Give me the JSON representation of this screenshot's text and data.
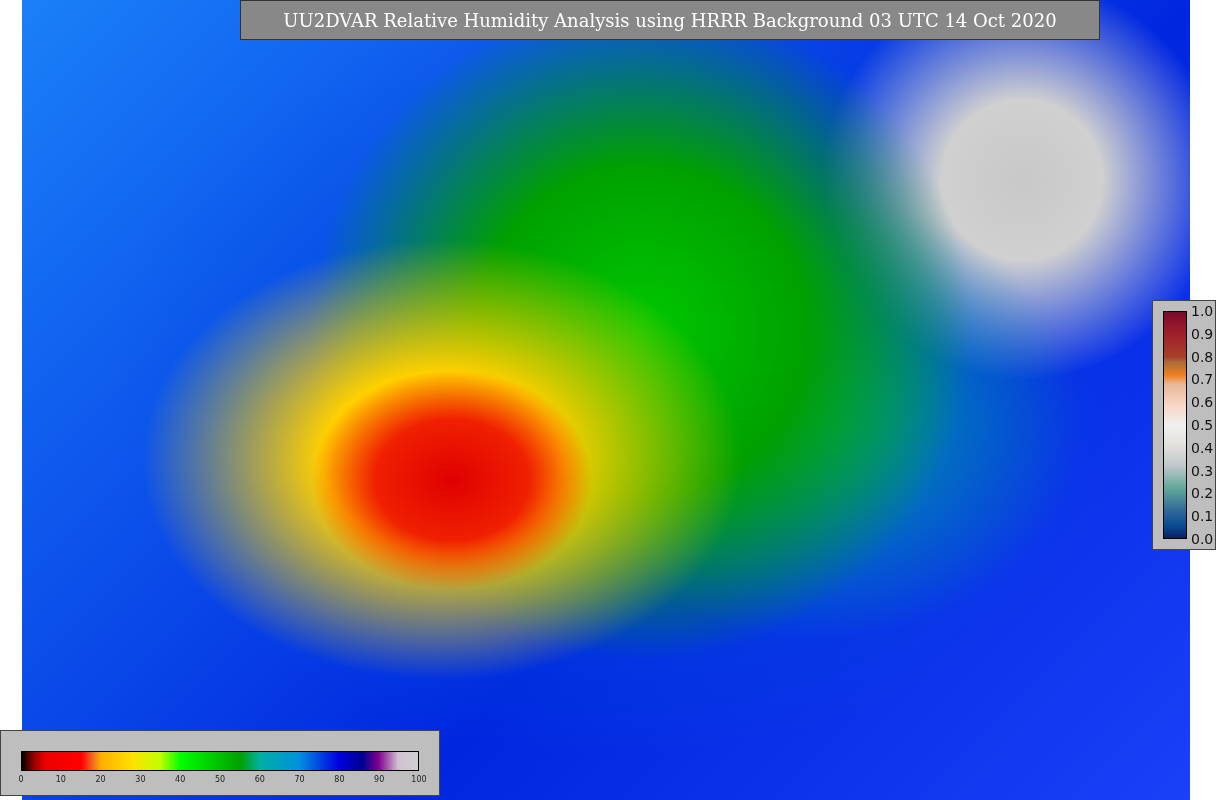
{
  "title": "UU2DVAR Relative Humidity Analysis using HRRR Background 03 UTC 14 Oct 2020",
  "humidity_colorbar": {
    "ticks": [
      "0",
      "10",
      "20",
      "30",
      "40",
      "50",
      "60",
      "70",
      "80",
      "90",
      "100"
    ]
  },
  "observation_colorbar": {
    "ticks": [
      "1.0",
      "0.9",
      "0.8",
      "0.7",
      "0.6",
      "0.5",
      "0.4",
      "0.3",
      "0.2",
      "0.1",
      "0.0"
    ]
  }
}
